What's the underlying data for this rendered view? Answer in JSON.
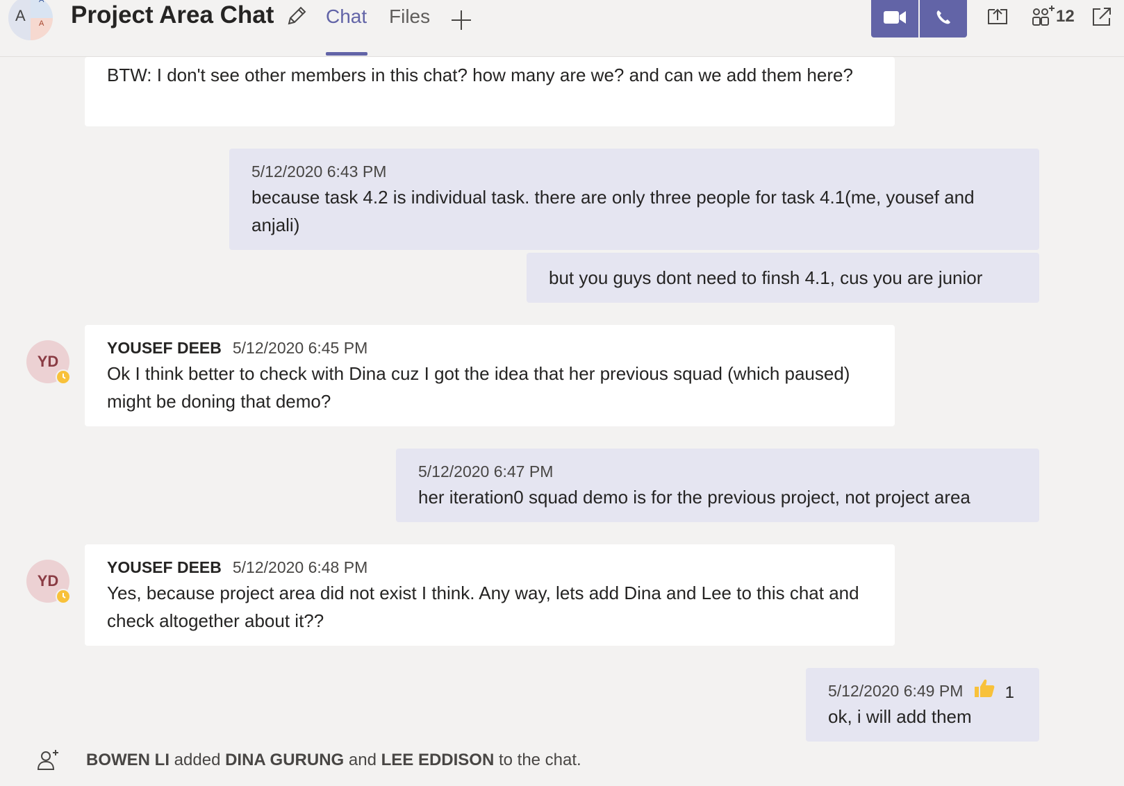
{
  "header": {
    "avatar_letters": [
      "A",
      "A",
      "A"
    ],
    "title": "Project Area Chat",
    "tabs": [
      {
        "label": "Chat",
        "active": true
      },
      {
        "label": "Files",
        "active": false
      }
    ],
    "participant_count": "12",
    "accent_color": "#6264a7",
    "icons": [
      "edit-icon",
      "add-tab-icon",
      "video-call-icon",
      "audio-call-icon",
      "share-screen-icon",
      "people-icon",
      "popout-icon"
    ]
  },
  "messages": [
    {
      "side": "other",
      "author": "",
      "time": "",
      "text": "BTW: I don't see other members in this chat? how many are we? and can we add them here?"
    },
    {
      "side": "mine",
      "time": "5/12/2020 6:43 PM",
      "text": "because task 4.2 is individual task. there are only three people for task 4.1(me, yousef and anjali)"
    },
    {
      "side": "mine",
      "time": "",
      "text": "but you guys dont need to finsh 4.1, cus you are junior"
    },
    {
      "side": "other",
      "avatar": "YD",
      "author": "YOUSEF DEEB",
      "time": "5/12/2020 6:45 PM",
      "text": "Ok I think better to check with Dina cuz I got the idea that her previous squad (which paused) might be doning that demo?"
    },
    {
      "side": "mine",
      "time": "5/12/2020 6:47 PM",
      "text": "her iteration0 squad demo is for the previous project, not project area"
    },
    {
      "side": "other",
      "avatar": "YD",
      "author": "YOUSEF DEEB",
      "time": "5/12/2020 6:48 PM",
      "text": "Yes, because project area did not exist I think. Any way, lets add Dina and Lee to this chat and check altogether about it??"
    },
    {
      "side": "mine",
      "time": "5/12/2020 6:49 PM",
      "text": "ok, i will add them",
      "reaction": {
        "icon": "thumbs-up-icon",
        "count": "1"
      }
    }
  ],
  "system_event": {
    "actor": "BOWEN LI",
    "verb": "added",
    "member1": "DINA GURUNG",
    "conj": "and",
    "member2": "LEE EDDISON",
    "suffix": "to the chat."
  },
  "colors": {
    "presence_away": "#f8c13a",
    "my_bubble": "#e5e5f1",
    "other_bubble": "#ffffff",
    "background": "#f3f2f1"
  }
}
